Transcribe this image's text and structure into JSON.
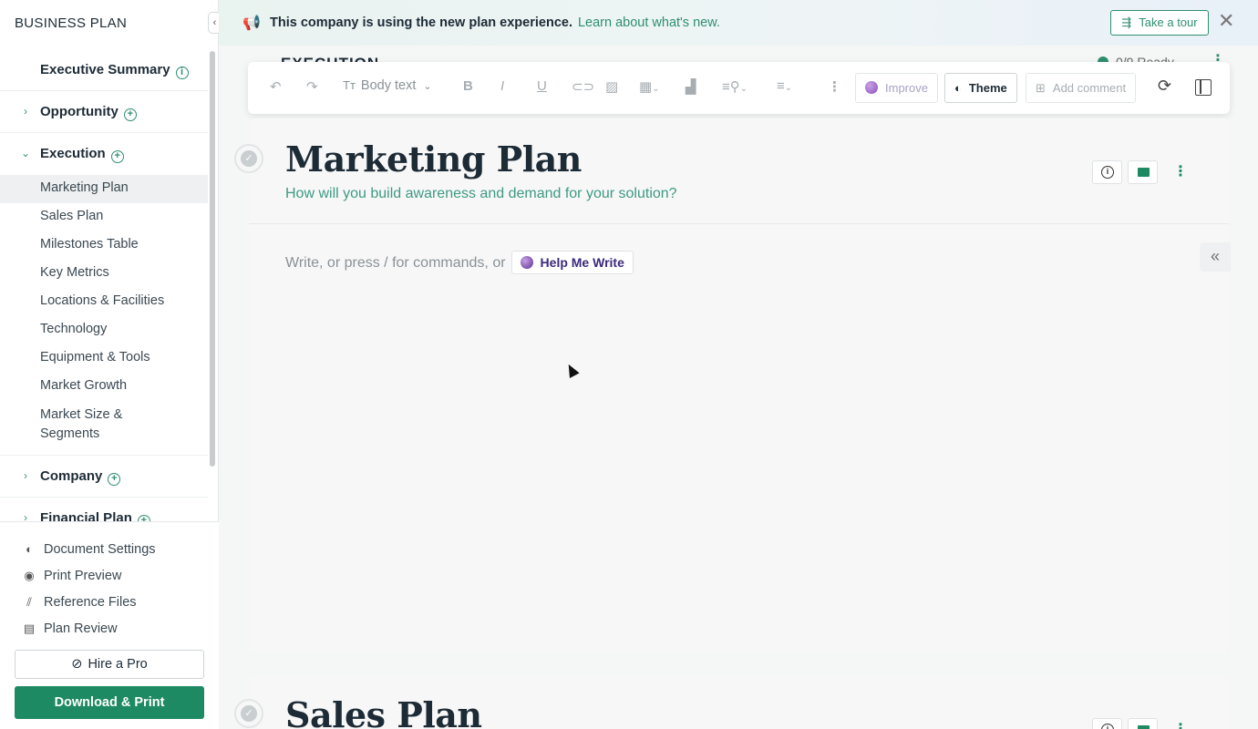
{
  "sidebar": {
    "title": "BUSINESS PLAN",
    "sections": [
      {
        "label": "Executive Summary",
        "icon": "info-icon",
        "chevron": ""
      },
      {
        "label": "Opportunity",
        "icon": "add-circle-icon",
        "chevron": "›"
      },
      {
        "label": "Execution",
        "icon": "add-circle-icon",
        "chevron": "⌄"
      }
    ],
    "execution_items": [
      "Marketing Plan",
      "Sales Plan",
      "Milestones Table",
      "Key Metrics",
      "Locations & Facilities",
      "Technology",
      "Equipment & Tools",
      "Market Growth",
      "Market Size & Segments"
    ],
    "lower_sections": [
      {
        "label": "Company",
        "chevron": "›"
      },
      {
        "label": "Financial Plan",
        "chevron": "›"
      }
    ],
    "links": [
      {
        "label": "Document Settings",
        "icon": "palette-icon"
      },
      {
        "label": "Print Preview",
        "icon": "eye-icon"
      },
      {
        "label": "Reference Files",
        "icon": "paperclip-icon"
      },
      {
        "label": "Plan Review",
        "icon": "review-icon"
      }
    ],
    "hire_label": "Hire a Pro",
    "download_label": "Download & Print"
  },
  "banner": {
    "text": "This company is using the new plan experience.",
    "link": "Learn about what's new.",
    "tour_label": "Take a tour"
  },
  "execution_header": {
    "title": "EXECUTION",
    "ready": "0/9 Ready"
  },
  "toolbar": {
    "text_style": "Body text",
    "improve_label": "Improve",
    "theme_label": "Theme",
    "comment_label": "Add comment"
  },
  "section1": {
    "title": "Marketing Plan",
    "subtitle": "How will you build awareness and demand for your solution?",
    "placeholder": "Write, or press / for commands, or",
    "help_label": "Help Me Write"
  },
  "section2": {
    "title": "Sales Plan"
  },
  "colors": {
    "accent": "#1e8a63",
    "subtitle": "#3d9a82",
    "text": "#1d2b36"
  }
}
